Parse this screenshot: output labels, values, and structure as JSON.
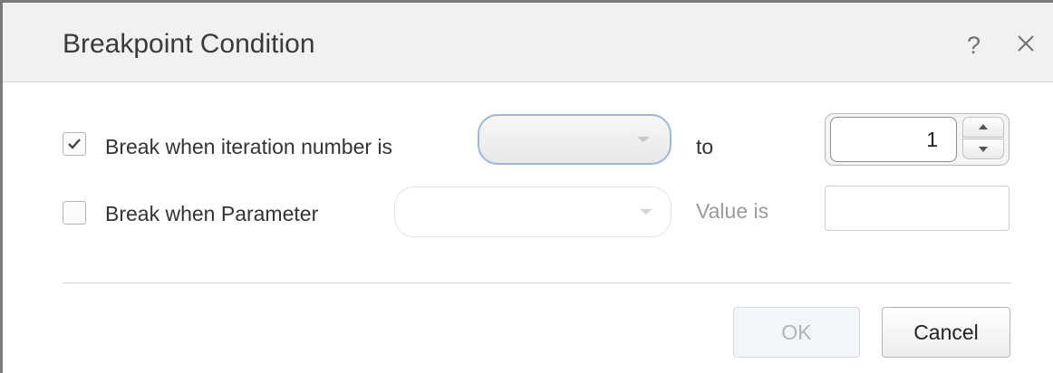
{
  "dialog": {
    "title": "Breakpoint Condition",
    "help_glyph": "?",
    "close_icon": "close-icon"
  },
  "iteration_row": {
    "checked": true,
    "label": "Break when iteration number is",
    "from_value": "",
    "to_label": "to",
    "to_value": "1"
  },
  "parameter_row": {
    "checked": false,
    "label": "Break when Parameter",
    "parameter_value": "",
    "value_label": "Value is",
    "value": ""
  },
  "buttons": {
    "ok_label": "OK",
    "cancel_label": "Cancel"
  },
  "colors": {
    "title_bar": "#f1f1f1",
    "active_combo_border": "#9db8d6",
    "disabled_text": "#9a9a9a"
  }
}
